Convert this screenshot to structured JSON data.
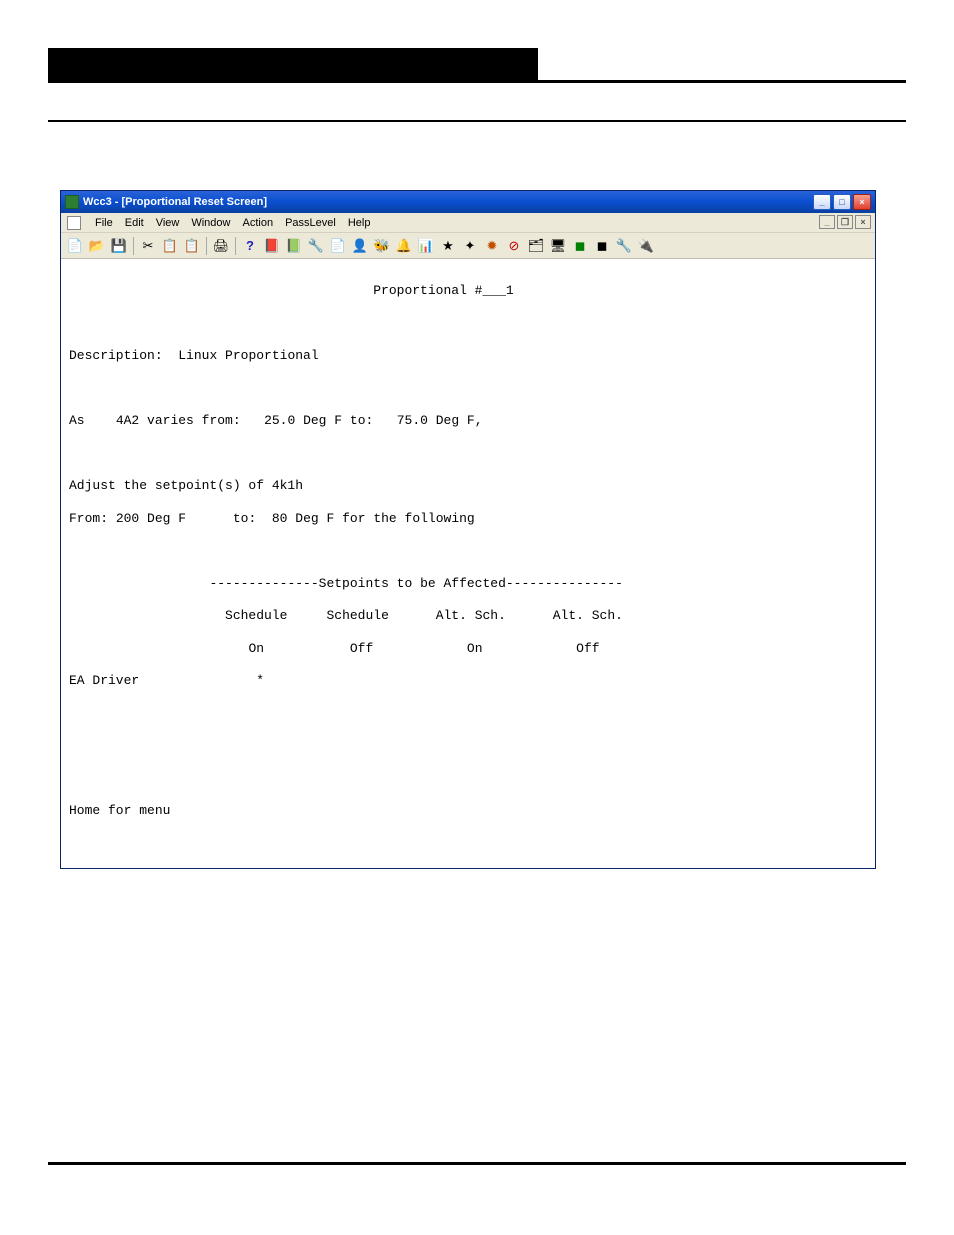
{
  "window": {
    "title": "Wcc3 - [Proportional Reset Screen]"
  },
  "menubar": {
    "items": [
      "File",
      "Edit",
      "View",
      "Window",
      "Action",
      "PassLevel",
      "Help"
    ]
  },
  "toolbar": {
    "icons": [
      "📄",
      "📂",
      "💾",
      "|",
      "✂",
      "📋",
      "📋",
      "|",
      "🖨",
      "|",
      "❓",
      "📚",
      "📚",
      "🔧",
      "📄",
      "👤",
      "🐝",
      "🔔",
      "📊",
      "⭐",
      "✨",
      "🔆",
      "🚫",
      "🗂",
      "🖥",
      "🟩",
      "⬛",
      "🔧",
      "🔌"
    ]
  },
  "content": {
    "title_label": "Proportional #___",
    "title_num": "1",
    "description_label": "Description:",
    "description_value": "Linux Proportional",
    "as_label": "As",
    "as_point": "4A2",
    "varies_label": "varies from:",
    "from_val": "25.0 Deg F",
    "to_label": "to:",
    "to_val": "75.0 Deg F,",
    "adjust_line1": "Adjust the setpoint(s) of 4k1h",
    "from2_label": "From:",
    "from2_val": "200 Deg F",
    "to2_label": "to:",
    "to2_val": "80 Deg F",
    "for_following": "for the following",
    "setpoints_divider": "--------------Setpoints to be Affected---------------",
    "col1a": "Schedule",
    "col2a": "Schedule",
    "col3a": "Alt. Sch.",
    "col4a": "Alt. Sch.",
    "col1b": "On",
    "col2b": "Off",
    "col3b": "On",
    "col4b": "Off",
    "row_label": "EA Driver",
    "row_mark": "*",
    "footer_hint": "Home for menu"
  }
}
